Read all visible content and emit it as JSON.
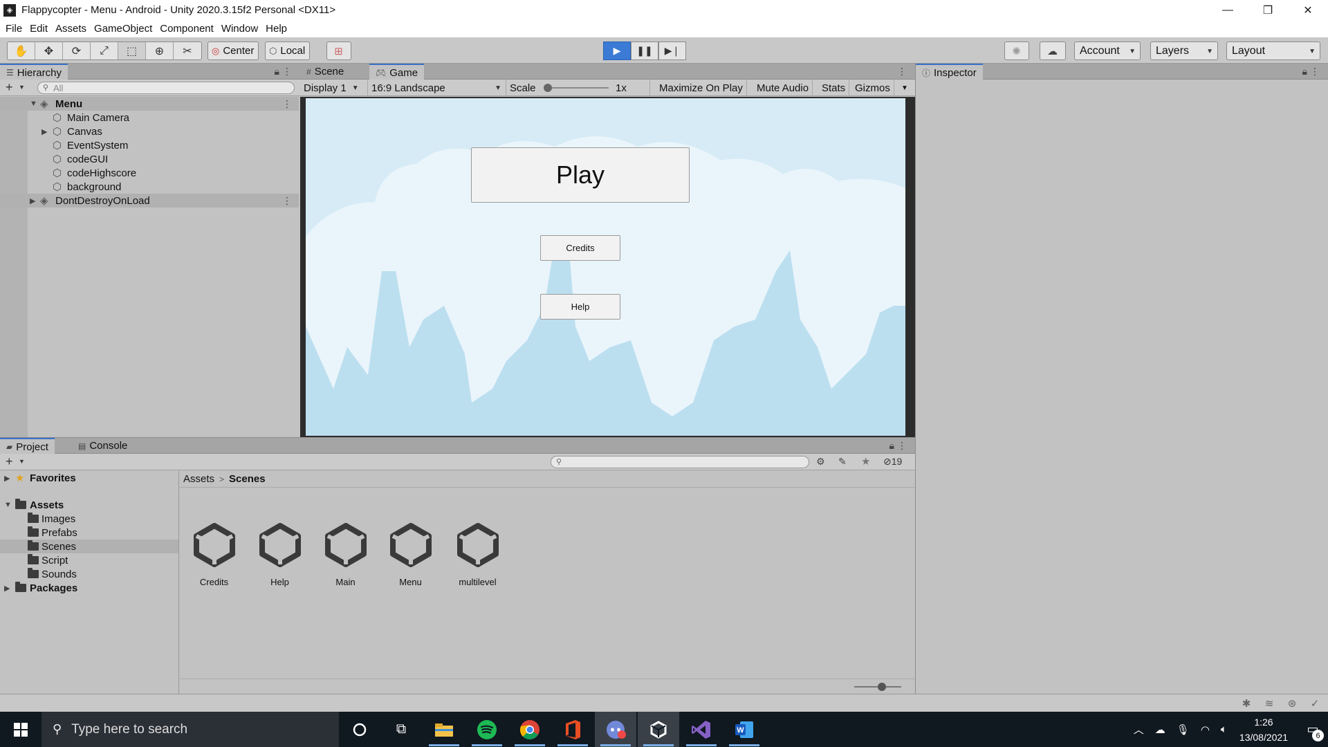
{
  "window": {
    "title": "Flappycopter - Menu - Android - Unity 2020.3.15f2 Personal <DX11>",
    "controls": [
      "—",
      "❐",
      "✕"
    ]
  },
  "menu": [
    "File",
    "Edit",
    "Assets",
    "GameObject",
    "Component",
    "Window",
    "Help"
  ],
  "toolbar": {
    "pivot_label": "Center",
    "space_label": "Local",
    "account_label": "Account",
    "layers_label": "Layers",
    "layout_label": "Layout"
  },
  "hierarchy": {
    "tab_label": "Hierarchy",
    "search_placeholder": "All",
    "scene_name": "Menu",
    "children": [
      "Main Camera",
      "Canvas",
      "EventSystem",
      "codeGUI",
      "codeHighscore",
      "background"
    ],
    "dont_destroy": "DontDestroyOnLoad"
  },
  "game_view": {
    "tabs": [
      "Scene",
      "Game"
    ],
    "display": "Display 1",
    "aspect": "16:9 Landscape",
    "scale_label": "Scale",
    "scale_value": "1x",
    "options": [
      "Maximize On Play",
      "Mute Audio",
      "Stats",
      "Gizmos"
    ],
    "buttons": {
      "play": "Play",
      "credits": "Credits",
      "help": "Help"
    }
  },
  "inspector": {
    "tab_label": "Inspector"
  },
  "project": {
    "tabs": [
      "Project",
      "Console"
    ],
    "favorites_label": "Favorites",
    "assets_label": "Assets",
    "folders": [
      "Images",
      "Prefabs",
      "Scenes",
      "Script",
      "Sounds"
    ],
    "packages_label": "Packages",
    "breadcrumb": [
      "Assets",
      "Scenes"
    ],
    "hidden_count": "19",
    "scenes": [
      "Credits",
      "Help",
      "Main",
      "Menu",
      "multilevel"
    ]
  },
  "taskbar": {
    "search_placeholder": "Type here to search",
    "time": "1:26",
    "date": "13/08/2021",
    "notification_count": "6"
  },
  "colors": {
    "accent": "#3b7bd5",
    "sky": "#d6ebf5",
    "cloud": "#eaf5fb",
    "rock": "#bcdff0"
  }
}
